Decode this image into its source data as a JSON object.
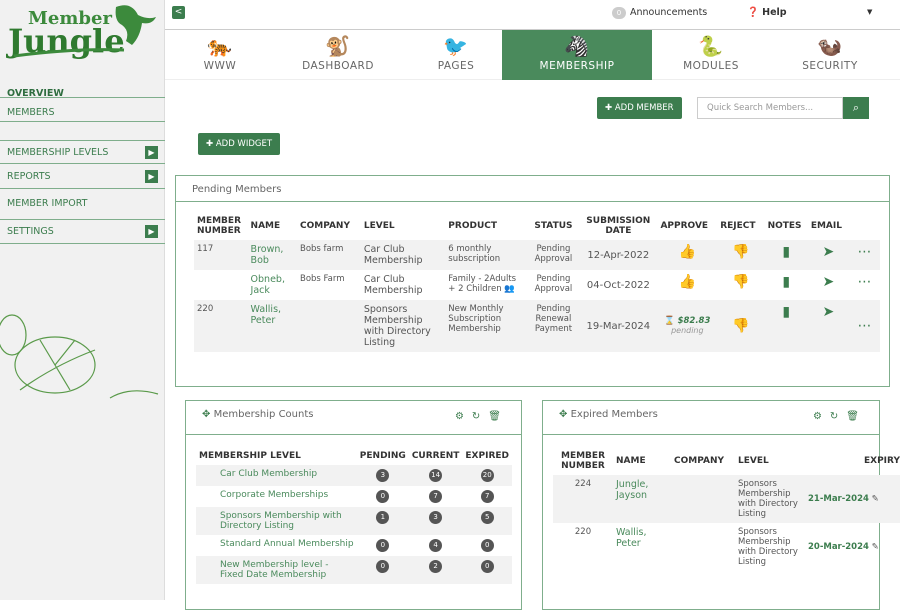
{
  "logo": {
    "line1": "Member",
    "line2": "Jungle"
  },
  "sidebar": {
    "items": [
      {
        "label": "OVERVIEW"
      },
      {
        "label": "MEMBERS"
      },
      {
        "label": "MEMBERSHIP LEVELS"
      },
      {
        "label": "REPORTS"
      },
      {
        "label": "MEMBER IMPORT"
      },
      {
        "label": "SETTINGS"
      }
    ]
  },
  "topbar": {
    "announcements_count": "0",
    "announcements": "Announcements",
    "help": "Help"
  },
  "tabs": [
    {
      "label": "WWW",
      "icon": "tiger-icon"
    },
    {
      "label": "DASHBOARD",
      "icon": "monkey-icon"
    },
    {
      "label": "PAGES",
      "icon": "toucan-icon"
    },
    {
      "label": "MEMBERSHIP",
      "icon": "zebra-icon"
    },
    {
      "label": "MODULES",
      "icon": "snake-icon"
    },
    {
      "label": "SECURITY",
      "icon": "meerkat-icon"
    }
  ],
  "actions": {
    "add_member": "ADD MEMBER",
    "search_placeholder": "Quick Search Members...",
    "add_widget": "ADD WIDGET"
  },
  "pending": {
    "title": "Pending Members",
    "headers": [
      "MEMBER NUMBER",
      "NAME",
      "COMPANY",
      "LEVEL",
      "PRODUCT",
      "STATUS",
      "SUBMISSION DATE",
      "APPROVE",
      "REJECT",
      "NOTES",
      "EMAIL"
    ],
    "rows": [
      {
        "number": "117",
        "name": "Brown, Bob",
        "company": "Bobs farm",
        "level": "Car Club Membership",
        "product": "6 monthly subscription",
        "status": "Pending Approval",
        "date": "12-Apr-2022"
      },
      {
        "number": "",
        "name": "Obneb, Jack",
        "company": "Bobs Farm",
        "level": "Car Club Membership",
        "product": "Family - 2Adults + 2 Children",
        "status": "Pending Approval",
        "date": "04-Oct-2022"
      },
      {
        "number": "220",
        "name": "Wallis, Peter",
        "company": "",
        "level": "Sponsors Membership with Directory Listing",
        "product": "New Monthly Subscription Membership",
        "status": "Pending Renewal Payment",
        "date": "19-Mar-2024",
        "amount": "$82.83",
        "amount_note": "pending"
      }
    ]
  },
  "counts": {
    "title": "Membership Counts",
    "headers": [
      "MEMBERSHIP LEVEL",
      "PENDING",
      "CURRENT",
      "EXPIRED"
    ],
    "rows": [
      {
        "level": "Car Club Membership",
        "pending": "3",
        "current": "14",
        "expired": "20"
      },
      {
        "level": "Corporate Memberships",
        "pending": "0",
        "current": "7",
        "expired": "7"
      },
      {
        "level": "Sponsors Membership with Directory Listing",
        "pending": "1",
        "current": "3",
        "expired": "5"
      },
      {
        "level": "Standard Annual Membership",
        "pending": "0",
        "current": "4",
        "expired": "0"
      },
      {
        "level": "New Membership level - Fixed Date Membership",
        "pending": "0",
        "current": "2",
        "expired": "0"
      }
    ]
  },
  "expired": {
    "title": "Expired Members",
    "headers": [
      "MEMBER NUMBER",
      "NAME",
      "COMPANY",
      "LEVEL",
      "EXPIRY"
    ],
    "rows": [
      {
        "number": "224",
        "name": "Jungle, Jayson",
        "company": "",
        "level": "Sponsors Membership with Directory Listing",
        "expiry": "21-Mar-2024"
      },
      {
        "number": "220",
        "name": "Wallis, Peter",
        "company": "",
        "level": "Sponsors Membership with Directory Listing",
        "expiry": "20-Mar-2024"
      }
    ]
  }
}
